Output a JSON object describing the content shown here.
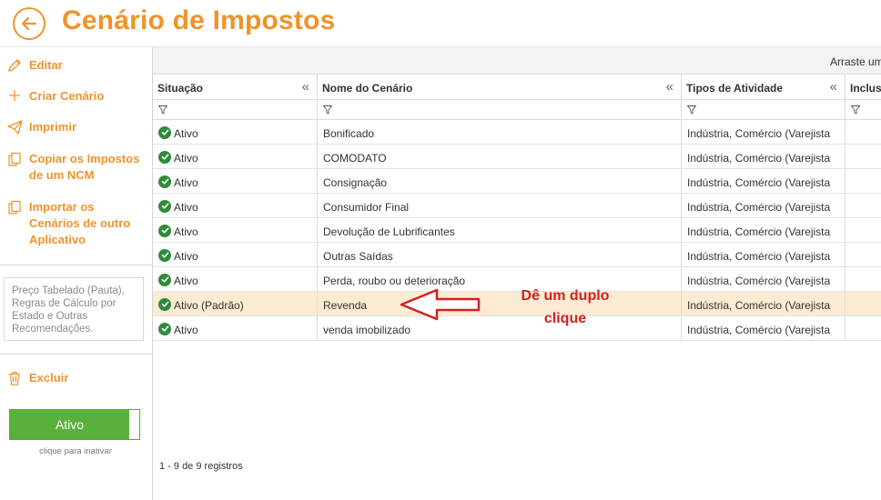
{
  "header": {
    "title": "Cenário de Impostos",
    "back_icon": "arrow-left-circle-icon",
    "accent_color": "#f0932b"
  },
  "sidebar": {
    "items": [
      {
        "label": "Editar",
        "icon": "pencil-icon"
      },
      {
        "label": "Criar Cenário",
        "icon": "plus-icon"
      },
      {
        "label": "Imprimir",
        "icon": "paper-plane-icon"
      },
      {
        "label": "Copiar os Impostos de um NCM",
        "icon": "copy-icon"
      },
      {
        "label": "Importar os Cenários de outro Aplicativo",
        "icon": "copy-icon"
      }
    ],
    "note": "Preço Tabelado (Pauta), Regras de Cálculo por Estado e Outras Recomendações.",
    "delete_label": "Excluir",
    "toggle_label": "Ativo",
    "toggle_hint": "clique para inativar",
    "toggle_color": "#58b13d"
  },
  "grid": {
    "group_hint": "Arraste um",
    "columns": [
      "Situação",
      "Nome do Cenário",
      "Tipos de Atividade",
      "Inclusa"
    ],
    "rows": [
      {
        "status": "Ativo",
        "name": "Bonificado",
        "activities": "Indústria, Comércio (Varejista"
      },
      {
        "status": "Ativo",
        "name": "COMODATO",
        "activities": "Indústria, Comércio (Varejista"
      },
      {
        "status": "Ativo",
        "name": "Consignação",
        "activities": "Indústria, Comércio (Varejista"
      },
      {
        "status": "Ativo",
        "name": "Consumidor Final",
        "activities": "Indústria, Comércio (Varejista"
      },
      {
        "status": "Ativo",
        "name": "Devolução de Lubrificantes",
        "activities": "Indústria, Comércio (Varejista"
      },
      {
        "status": "Ativo",
        "name": "Outras Saídas",
        "activities": "Indústria, Comércio (Varejista"
      },
      {
        "status": "Ativo",
        "name": "Perda, roubo ou deterioração",
        "activities": "Indústria, Comércio (Varejista"
      },
      {
        "status": "Ativo (Padrão)",
        "name": "Revenda",
        "activities": "Indústria, Comércio (Varejista",
        "selected": true
      },
      {
        "status": "Ativo",
        "name": "venda imobilizado",
        "activities": "Indústria, Comércio (Varejista"
      }
    ],
    "footer": "1 - 9 de 9 registros",
    "selected_color": "#fdebd3"
  },
  "annotation": {
    "line1": "Dê um duplo",
    "line2": "clique",
    "color": "#d32020"
  }
}
